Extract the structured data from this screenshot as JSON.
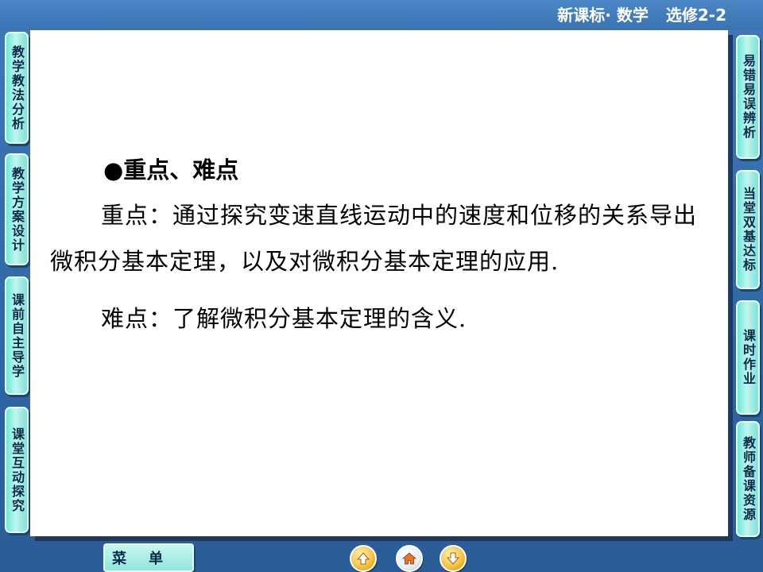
{
  "header": {
    "series": "新课标· 数学",
    "volume": "选修2-2"
  },
  "left_nav": [
    {
      "label": "教学教法分析"
    },
    {
      "label": "教学方案设计"
    },
    {
      "label": "课前自主导学"
    },
    {
      "label": "课堂互动探究"
    }
  ],
  "right_nav": [
    {
      "label": "易错易误辨析"
    },
    {
      "label": "当堂双基达标"
    },
    {
      "label": "课时作业"
    },
    {
      "label": "教师备课资源"
    }
  ],
  "content": {
    "heading": "●重点、难点",
    "key_point": "重点：通过探究变速直线运动中的速度和位移的关系导出微积分基本定理，以及对微积分基本定理的应用.",
    "difficulty": "难点：了解微积分基本定理的含义."
  },
  "bottom": {
    "menu_label": "菜单"
  },
  "icons": {
    "prev": "up-arrow-icon",
    "home": "home-icon",
    "next": "down-arrow-icon"
  },
  "colors": {
    "background": "#3a73b2",
    "nav_button": "#8ee6dc",
    "nav_arrow": "#f5c542"
  }
}
